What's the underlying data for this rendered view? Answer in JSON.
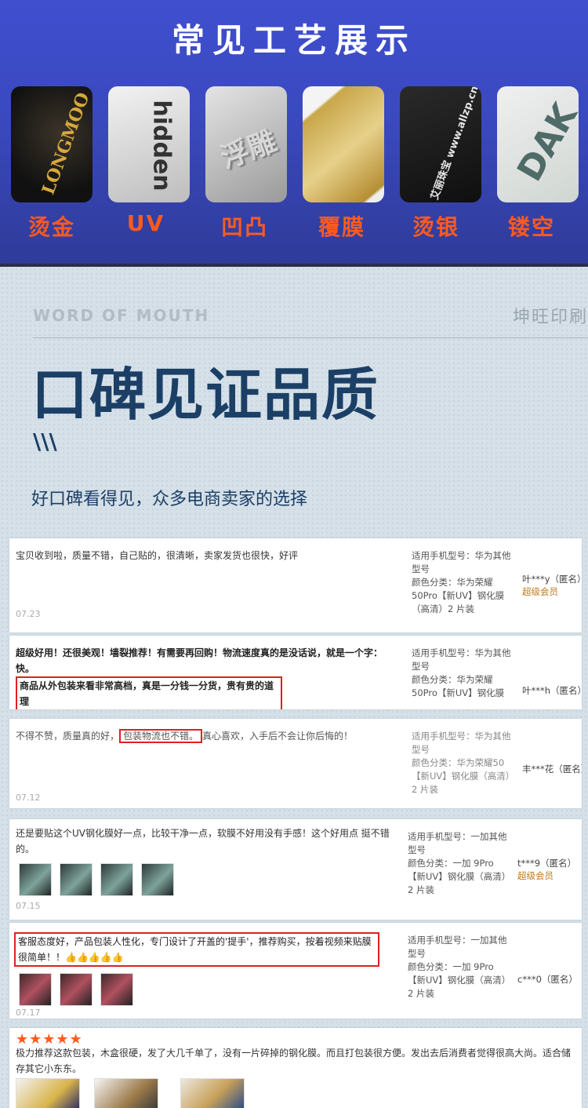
{
  "banner": {
    "title": "常见工艺展示",
    "items": [
      {
        "label": "烫金",
        "art": "LONGMOO"
      },
      {
        "label": "UV",
        "art": "hidden"
      },
      {
        "label": "凹凸",
        "art": "浮雕"
      },
      {
        "label": "覆膜",
        "art": ""
      },
      {
        "label": "烫银",
        "art": "艾丽珠宝 www.allzp.cn"
      },
      {
        "label": "镂空",
        "art": "DAK"
      }
    ]
  },
  "section": {
    "eyebrow": "WORD OF MOUTH",
    "brand": "坤旺印刷",
    "heading": "口碑见证品质",
    "slashes": "\\\\\\",
    "subtitle": "好口碑看得见，众多电商卖家的选择"
  },
  "reviews": [
    {
      "text": "宝贝收到啦，质量不错，自己贴的，很清晰，卖家发货也很快，好评",
      "date": "07.23",
      "spec": "适用手机型号：华为其他型号\n颜色分类：华为荣耀50Pro【新UV】钢化膜（高清）2 片装",
      "user": "叶***y（匿名）",
      "vip": "超级会员"
    },
    {
      "text_a": "超级好用！还很美观！墙裂推荐！有需要再回购！物流速度真的是没话说，就是一个字：快。",
      "text_b": "商品从外包装来看非常高档，真是一分钱一分货，贵有贵的道理",
      "spec": "适用手机型号：华为其他型号\n颜色分类：华为荣耀50Pro【新UV】钢化膜",
      "user": "叶***h（匿名）"
    },
    {
      "text_a": "不得不赞，质量真的好，",
      "text_hl": "包装物流也不错。",
      "text_b": "真心喜欢，入手后不会让你后悔的！",
      "date": "07.12",
      "spec": "适用手机型号：华为其他型号\n颜色分类：华为荣耀50【新UV】钢化膜（高清）2 片装",
      "user": "丰***花（匿名）"
    },
    {
      "text": "还是要贴这个UV钢化膜好一点，比较干净一点，软膜不好用没有手感！这个好用点 挺不错的。",
      "date": "07.15",
      "spec": "适用手机型号：一加其他型号\n颜色分类：一加 9Pro【新UV】钢化膜（高清）2 片装",
      "user": "t***9（匿名）",
      "vip": "超级会员"
    },
    {
      "text": "客服态度好，产品包装人性化，专门设计了开盖的'提手'，推荐购买，按着视频来贴膜很简单！！👍👍👍👍👍",
      "date": "07.17",
      "spec": "适用手机型号：一加其他型号\n颜色分类：一加 9Pro【新UV】钢化膜（高清）2 片装",
      "user": "c***0（匿名）"
    },
    {
      "stars": "★★★★★",
      "text": "极力推荐这款包装，木盒很硬，发了大几千单了，没有一片碎掉的钢化膜。而且打包装很方便。发出去后消费者觉得很高大尚。适合储存其它小东东。"
    }
  ]
}
